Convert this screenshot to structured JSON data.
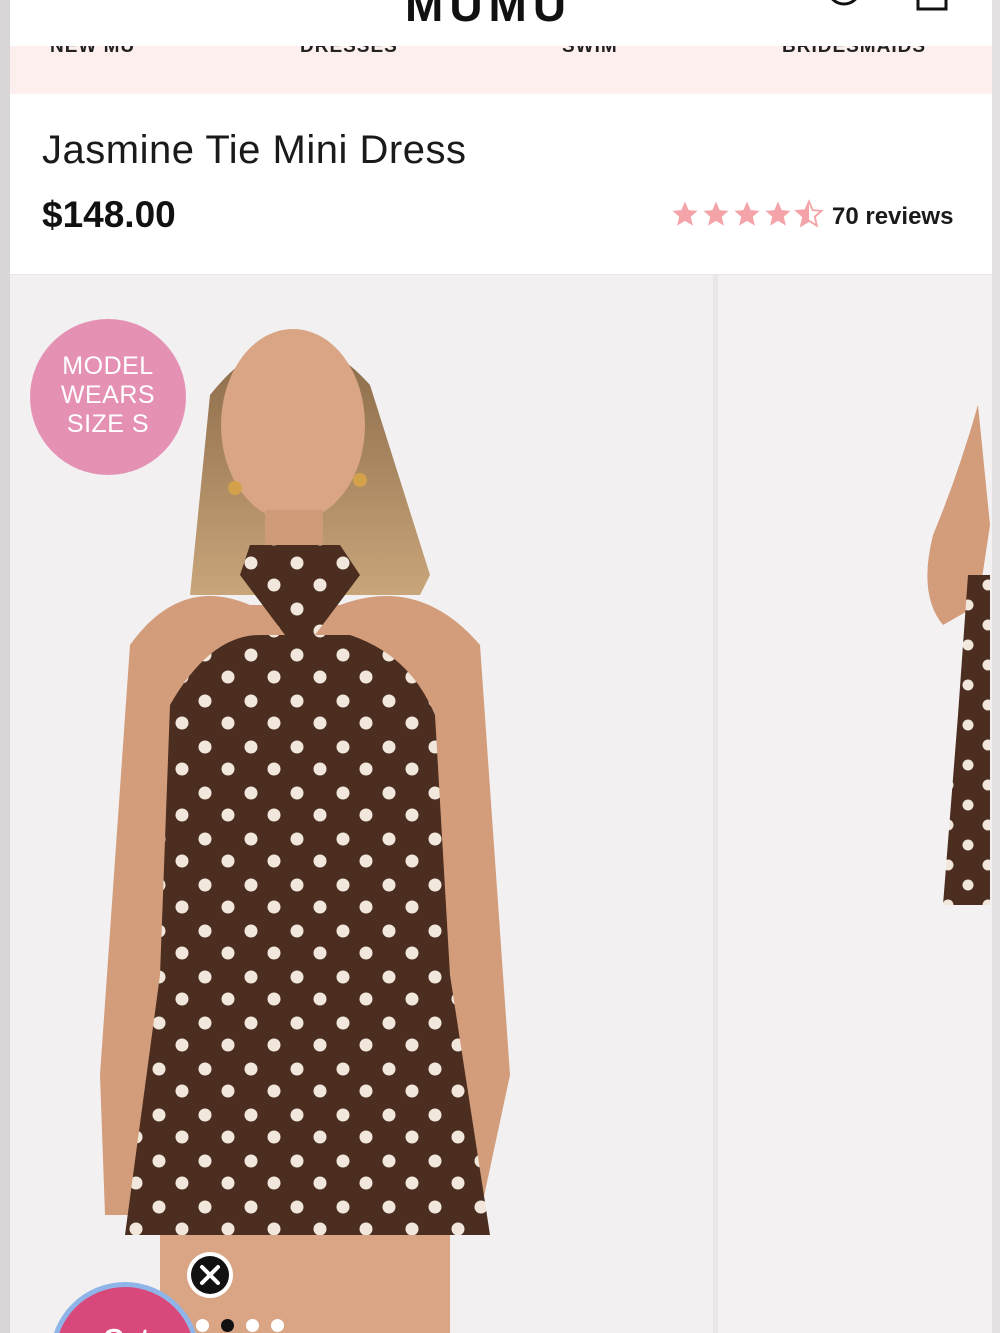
{
  "header": {
    "logo": "MUMU",
    "account_icon": "account-icon",
    "bag_icon": "shopping-bag-icon"
  },
  "nav": {
    "items": [
      "NEW MU",
      "DRESSES",
      "SWIM",
      "BRIDESMAIDS"
    ]
  },
  "product": {
    "title": "Jasmine Tie Mini Dress",
    "price": "$148.00",
    "rating": 4.5,
    "rating_max": 5,
    "reviews_label": "70 reviews",
    "star_color": "#f4a3a8"
  },
  "gallery": {
    "badge_lines": [
      "MODEL",
      "WEARS",
      "SIZE S"
    ],
    "badge_color": "#e491b4",
    "images": [
      {
        "icon": "model-photo-front"
      },
      {
        "icon": "model-photo-side"
      }
    ],
    "dots_total": 4,
    "dots_active": 2
  },
  "popup": {
    "button_label": "Get",
    "close_icon": "close-icon",
    "button_color": "#d9487a"
  }
}
